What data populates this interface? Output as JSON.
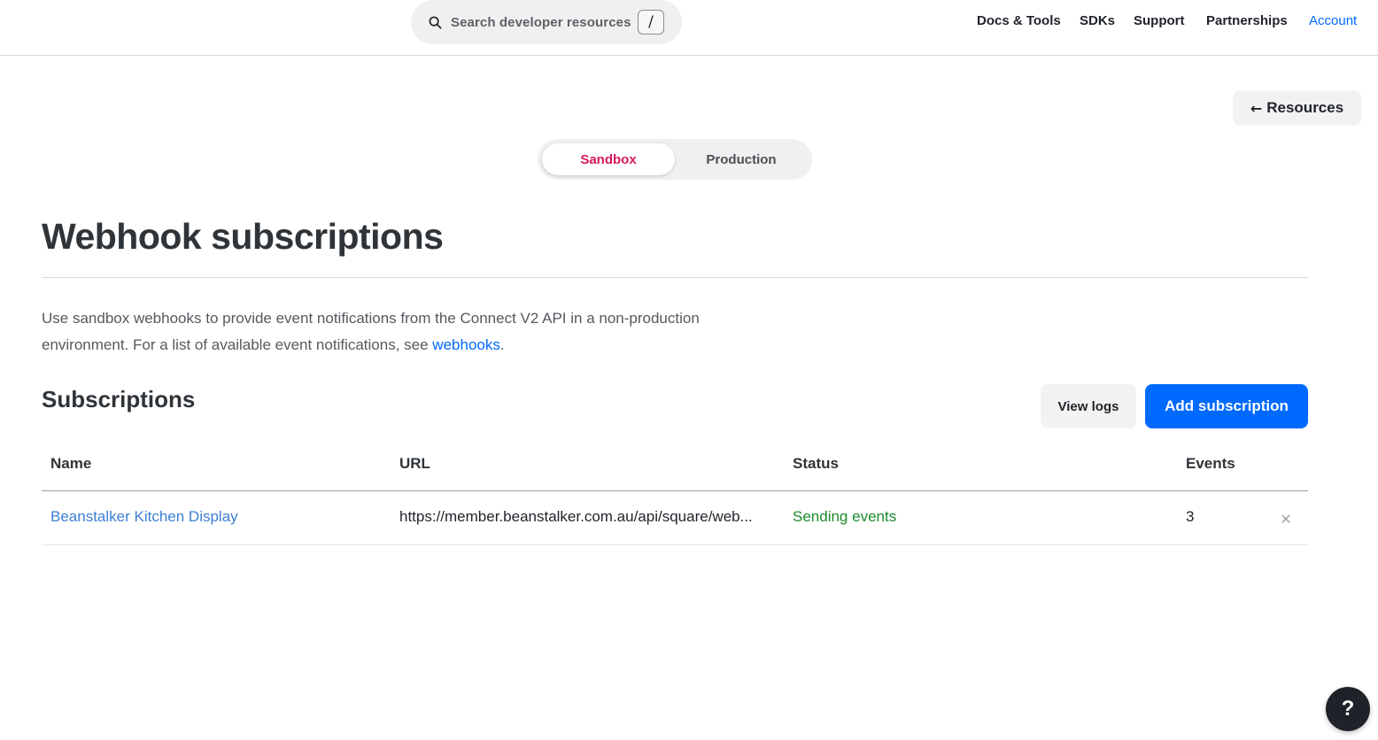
{
  "header": {
    "search": {
      "placeholder": "Search developer resources",
      "shortcut": "/",
      "icon": "search-icon"
    },
    "nav": [
      "Docs & Tools",
      "SDKs",
      "Support",
      "Partnerships",
      "Account"
    ]
  },
  "resources_button": {
    "label": "Resources",
    "icon": "arrow-left-icon"
  },
  "environment": {
    "options": [
      "Sandbox",
      "Production"
    ],
    "selected": "Sandbox"
  },
  "page": {
    "title": "Webhook subscriptions",
    "description_pre": "Use sandbox webhooks to provide event notifications from the Connect V2 API in a non-production environment. For a list of available event notifications, see ",
    "description_link": "webhooks",
    "description_post": "."
  },
  "subscriptions": {
    "heading": "Subscriptions",
    "view_logs_label": "View logs",
    "add_label": "Add subscription",
    "columns": [
      "Name",
      "URL",
      "Status",
      "Events"
    ],
    "rows": [
      {
        "name": "Beanstalker Kitchen Display",
        "url": "https://member.beanstalker.com.au/api/square/web...",
        "status": "Sending events",
        "events": "3",
        "delete_icon": "close-icon"
      }
    ]
  },
  "help": {
    "label": "?",
    "icon": "help-icon"
  },
  "colors": {
    "accent": "#006aff",
    "sandbox": "#d6195f",
    "status_ok": "#1a8a2c",
    "link_row": "#3c7fd6"
  }
}
